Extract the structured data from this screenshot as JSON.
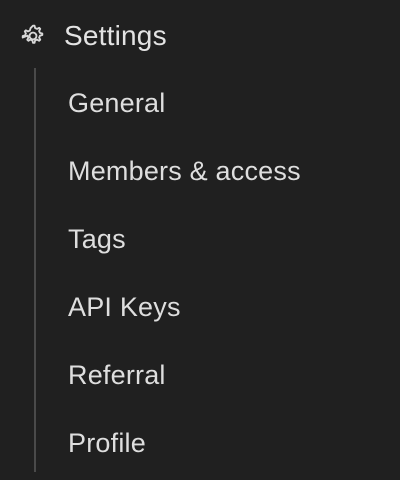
{
  "settings": {
    "icon": "gear-icon",
    "title": "Settings",
    "items": [
      {
        "label": "General"
      },
      {
        "label": "Members & access"
      },
      {
        "label": "Tags"
      },
      {
        "label": "API Keys"
      },
      {
        "label": "Referral"
      },
      {
        "label": "Profile"
      }
    ]
  },
  "colors": {
    "background": "#202020",
    "text": "#dedede",
    "tree_line": "#4a4a4a",
    "icon": "#d8d8d8"
  }
}
